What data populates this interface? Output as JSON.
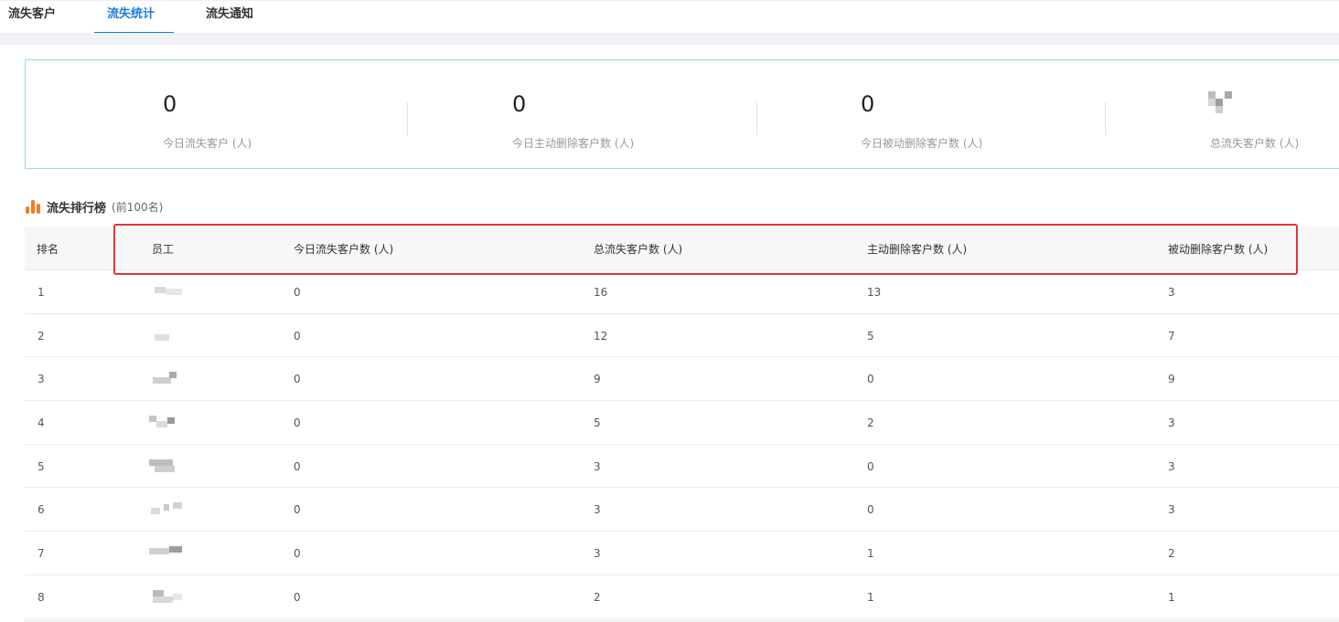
{
  "tabs": [
    {
      "label": "流失客户",
      "active": false
    },
    {
      "label": "流失统计",
      "active": true
    },
    {
      "label": "流失通知",
      "active": false
    }
  ],
  "stats": [
    {
      "value": "0",
      "label": "今日流失客户 (人)"
    },
    {
      "value": "0",
      "label": "今日主动删除客户数 (人)"
    },
    {
      "value": "0",
      "label": "今日被动删除客户数 (人)"
    },
    {
      "value": "",
      "label": "总流失客户数 (人)"
    }
  ],
  "ranking": {
    "title": "流失排行榜",
    "subtitle": "(前100名)",
    "icon": "bar-chart-icon",
    "accent": "#f77b1a"
  },
  "table": {
    "headers": [
      "排名",
      "员工",
      "今日流失客户数 (人)",
      "总流失客户数 (人)",
      "主动删除客户数 (人)",
      "被动删除客户数 (人)"
    ],
    "rows": [
      {
        "rank": "1",
        "today": "0",
        "total": "16",
        "active": "13",
        "passive": "3"
      },
      {
        "rank": "2",
        "today": "0",
        "total": "12",
        "active": "5",
        "passive": "7"
      },
      {
        "rank": "3",
        "today": "0",
        "total": "9",
        "active": "0",
        "passive": "9"
      },
      {
        "rank": "4",
        "today": "0",
        "total": "5",
        "active": "2",
        "passive": "3"
      },
      {
        "rank": "5",
        "today": "0",
        "total": "3",
        "active": "0",
        "passive": "3"
      },
      {
        "rank": "6",
        "today": "0",
        "total": "3",
        "active": "0",
        "passive": "3"
      },
      {
        "rank": "7",
        "today": "0",
        "total": "3",
        "active": "1",
        "passive": "2"
      },
      {
        "rank": "8",
        "today": "0",
        "total": "2",
        "active": "1",
        "passive": "1"
      }
    ]
  },
  "colors": {
    "tab_active": "#1f7be0",
    "highlight_border": "#e53333",
    "stats_border": "#9fd6e6"
  }
}
